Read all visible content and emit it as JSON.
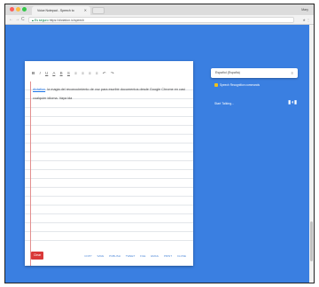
{
  "browser": {
    "tab_title": "Voice Notepad - Speech to",
    "new_tab": "",
    "user_name": "Mary",
    "secure_label": "Es seguro",
    "url": "https://dictation.io/speech"
  },
  "editor": {
    "toolbar": [
      "B",
      "I",
      "U",
      "A",
      "B",
      "S",
      "≡",
      "≡",
      "≡",
      "≡",
      "↶",
      "↷"
    ],
    "link_text": "dictation",
    "body_text": ". la magia del reconocimiento de voz para escribir documentos desde Google Chrome en casi cualquier idioma. Vaya ida",
    "clear_label": "Clear",
    "actions": [
      "COPY",
      "SAVE",
      "PUBLISH",
      "TWEET",
      "FILE",
      "EMAIL",
      "PRINT",
      "CLOSE"
    ]
  },
  "sidebar": {
    "language": "Español (España)",
    "hint": "Speech Recognition commands",
    "say_hello": "Start Talking..."
  },
  "colors": {
    "background": "#3a7fe1",
    "clear_button": "#d93838",
    "hint_icon": "#f1c21b"
  }
}
